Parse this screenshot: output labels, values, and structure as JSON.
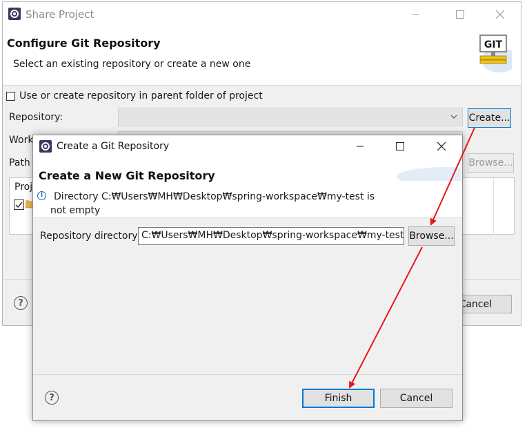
{
  "outer": {
    "title": "Share Project",
    "header_title": "Configure Git Repository",
    "header_desc": "Select an existing repository or create a new one",
    "use_parent_label": "Use or create repository in parent folder of project",
    "repository_label": "Repository:",
    "working_dir_label": "Work",
    "path_label": "Path",
    "create_button": "Create...",
    "browse_button": "Browse...",
    "projects_header": "Proj",
    "cancel_button": "Cancel",
    "git_logo_text": "GIT"
  },
  "inner": {
    "title": "Create a Git Repository",
    "header_title": "Create a New Git Repository",
    "info_line1": "Directory C:₩Users₩MH₩Desktop₩spring-workspace₩my-test is",
    "info_line2": "not empty",
    "repo_dir_label": "Repository directory:",
    "repo_dir_value": "C:₩Users₩MH₩Desktop₩spring-workspace₩my-test",
    "browse_button": "Browse...",
    "finish_button": "Finish",
    "cancel_button": "Cancel"
  },
  "colors": {
    "annotation_arrow": "#e8141b",
    "dialog_bg": "#f0f0f0",
    "header_bg": "#ffffff"
  }
}
